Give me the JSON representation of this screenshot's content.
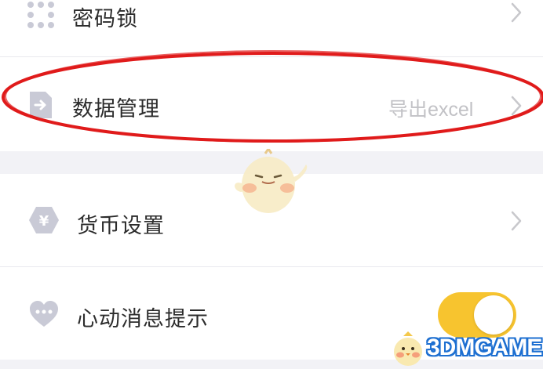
{
  "settings": {
    "items": [
      {
        "label": "密码锁",
        "icon": "dots-grid-icon",
        "value": ""
      },
      {
        "label": "数据管理",
        "icon": "export-file-icon",
        "value": "导出excel"
      },
      {
        "label": "货币设置",
        "icon": "yen-hexagon-icon",
        "value": ""
      },
      {
        "label": "心动消息提示",
        "icon": "heart-chat-icon",
        "value": ""
      }
    ],
    "heart_message_toggle": {
      "on": true
    }
  },
  "colors": {
    "background": "#f2f2f6",
    "accent_toggle": "#f7c42f",
    "icon_gray": "#c9cad6",
    "annotation_red": "#e01b1b",
    "watermark_blue": "#1d6fd1"
  },
  "watermark": {
    "text": "3DMGAME"
  }
}
